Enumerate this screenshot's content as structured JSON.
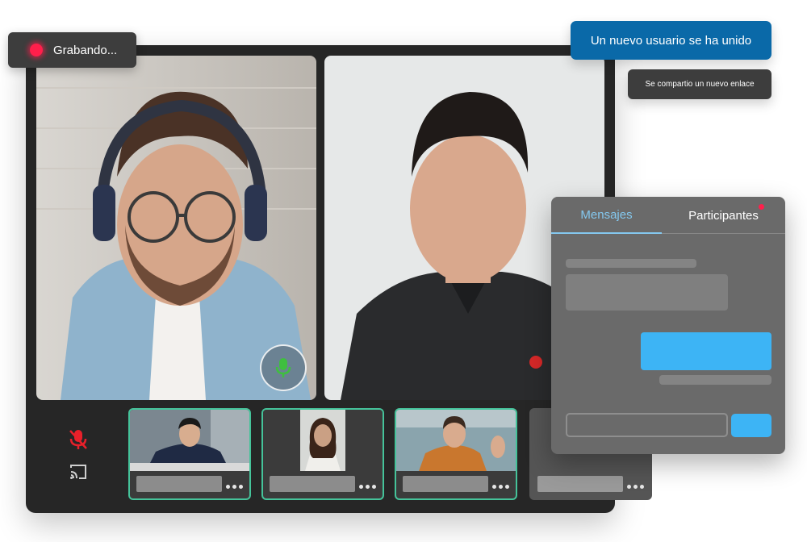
{
  "recording": {
    "label": "Grabando..."
  },
  "notifications": {
    "user_joined": "Un nuevo usuario se ha unido",
    "link_shared": "Se compartio un nuevo enlace"
  },
  "chat": {
    "tabs": [
      {
        "label": "Mensajes",
        "active": true
      },
      {
        "label": "Participantes",
        "active": false,
        "has_unread": true
      }
    ]
  },
  "controls": {
    "icons": [
      "mic-muted-icon",
      "cast-icon",
      "mic-active-icon"
    ]
  },
  "participants": [
    {
      "id": "thumb-1",
      "active": true
    },
    {
      "id": "thumb-2",
      "active": true
    },
    {
      "id": "thumb-3",
      "active": true
    },
    {
      "id": "thumb-4",
      "active": false
    }
  ],
  "colors": {
    "accent": "#3db4f5",
    "record": "#ff1f4b",
    "active_border": "#45c39a",
    "toast_primary": "#0a69a8",
    "mic_active": "#3fbf3f",
    "mic_muted": "#e8202a"
  }
}
